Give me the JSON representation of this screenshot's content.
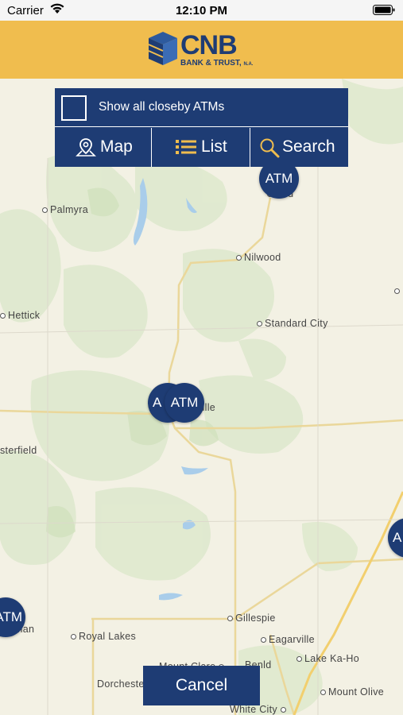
{
  "status_bar": {
    "carrier": "Carrier",
    "time": "12:10 PM"
  },
  "header": {
    "logo_name": "CNB",
    "logo_sub": "BANK & TRUST",
    "logo_suffix": "N.A.",
    "brand_color": "#f0bd4e",
    "accent_color": "#1e3c74"
  },
  "controls": {
    "show_all_label": "Show all closeby ATMs",
    "show_all_checked": false,
    "map_label": "Map",
    "list_label": "List",
    "search_label": "Search"
  },
  "map": {
    "towns": [
      "Palmyra",
      "Nilwood",
      "Hettick",
      "Standard City",
      "ville",
      "sterfield",
      "Gillespie",
      "Royal Lakes",
      "Eagarville",
      "Mount Clare",
      "Benld",
      "Lake Ka-Ho",
      "Dorchester",
      "Mount Olive",
      "White City",
      "rard",
      "man"
    ],
    "atm_label": "ATM",
    "atm_partial": "A"
  },
  "cancel_label": "Cancel"
}
